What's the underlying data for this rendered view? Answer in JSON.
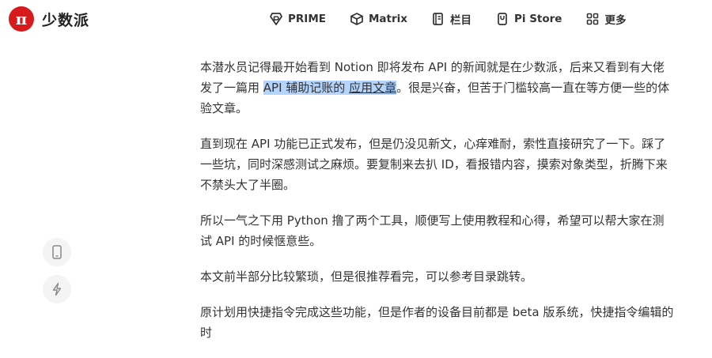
{
  "header": {
    "logo_glyph": "π",
    "logo_text": "少数派",
    "brand_color": "#d71a1b",
    "nav": [
      {
        "label": "PRIME",
        "icon": "prime-icon"
      },
      {
        "label": "Matrix",
        "icon": "matrix-icon"
      },
      {
        "label": "栏目",
        "icon": "columns-icon"
      },
      {
        "label": "Pi Store",
        "icon": "store-icon"
      },
      {
        "label": "更多",
        "icon": "grid-icon"
      }
    ]
  },
  "sidebar": {
    "buttons": [
      {
        "icon": "mobile-icon"
      },
      {
        "icon": "lightning-icon"
      }
    ]
  },
  "article": {
    "p1_before": "本潜水员记得最开始看到 Notion 即将发布 API 的新闻就是在少数派，后来又看到有大佬发了一篇用 ",
    "p1_highlight_text": "API 辅助记账的 ",
    "p1_link": "应用文章",
    "p1_after": "。很是兴奋，但苦于门槛较高一直在等方便一些的体验文章。",
    "p2": "直到现在 API 功能已正式发布，但是仍没见新文，心痒难耐，索性直接研究了一下。踩了一些坑，同时深感测试之麻烦。要复制来去扒 ID，看报错内容，摸索对象类型，折腾下来不禁头大了半圈。",
    "p3": "所以一气之下用 Python 撸了两个工具，顺便写上使用教程和心得，希望可以帮大家在测试 API 的时候惬意些。",
    "p4": "本文前半部分比较繁琐，但是很推荐看完，可以参考目录跳转。",
    "p5": "原计划用快捷指令完成这些功能，但是作者的设备目前都是 beta 版系统，快捷指令编辑的时"
  }
}
